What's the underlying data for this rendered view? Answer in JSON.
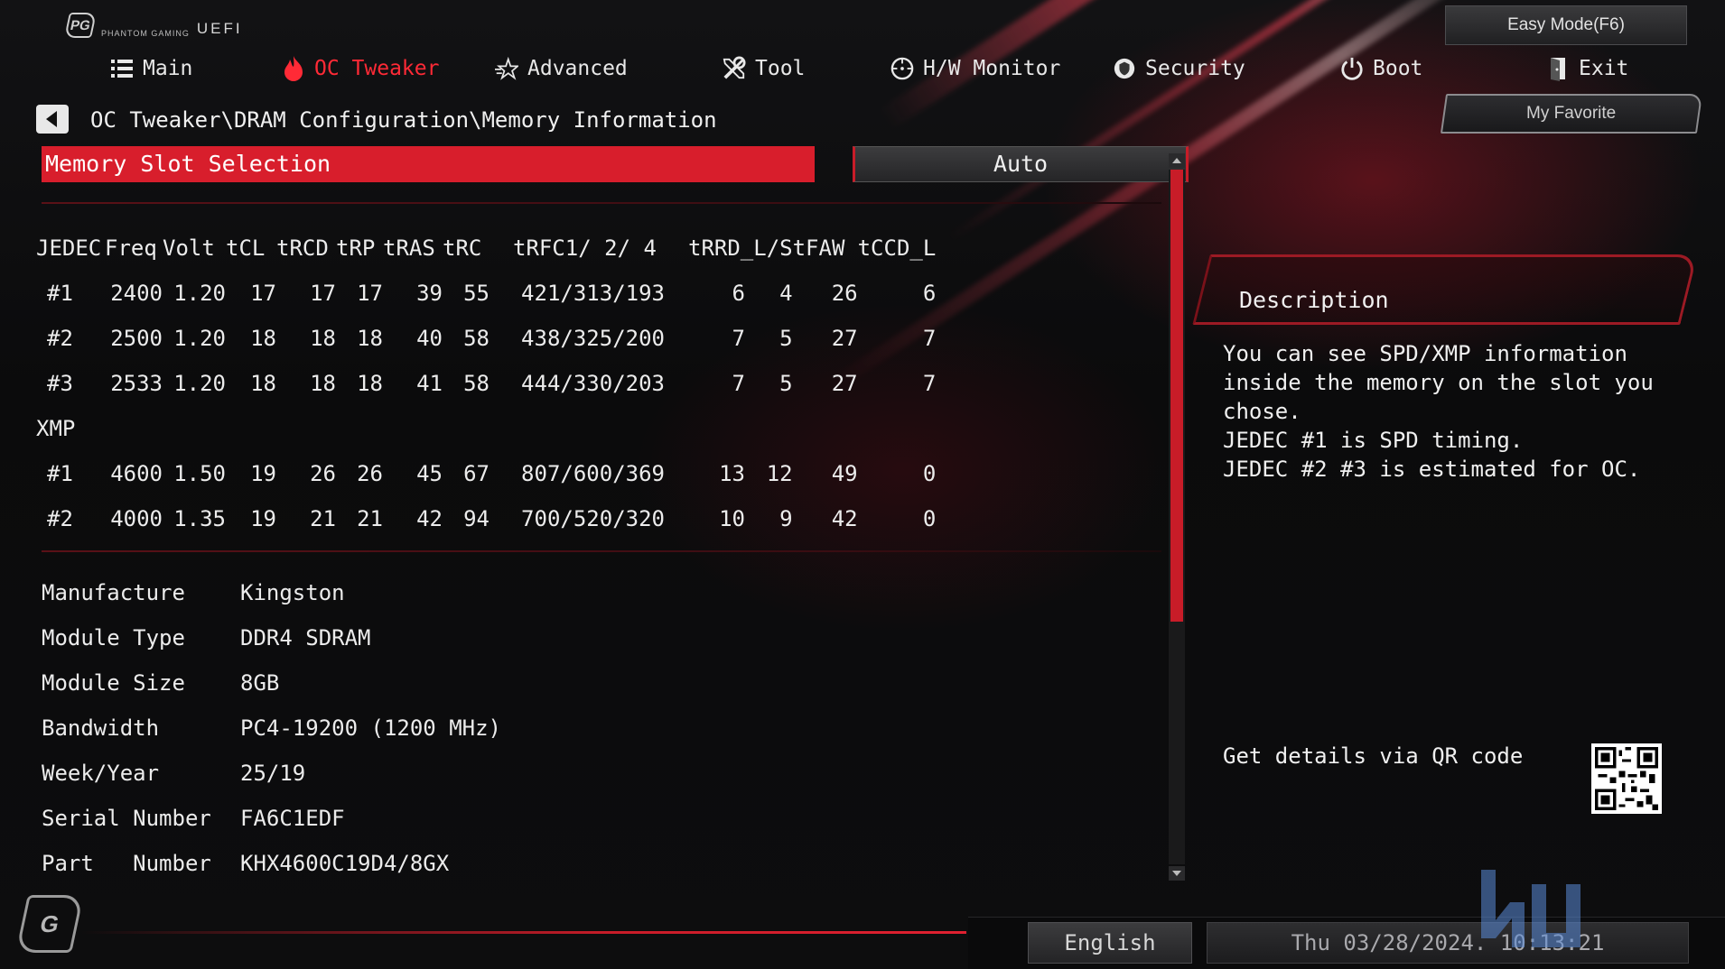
{
  "header": {
    "brand_text": "PHANTOM GAMING",
    "uefi_label": "UEFI",
    "easy_mode_label": "Easy Mode(F6)",
    "my_favorite_label": "My Favorite"
  },
  "nav": {
    "items": [
      {
        "label": "Main",
        "icon": "list-icon"
      },
      {
        "label": "OC Tweaker",
        "icon": "flame-icon",
        "active": true
      },
      {
        "label": "Advanced",
        "icon": "star-icon"
      },
      {
        "label": "Tool",
        "icon": "tools-icon"
      },
      {
        "label": "H/W Monitor",
        "icon": "monitor-gauge-icon"
      },
      {
        "label": "Security",
        "icon": "shield-icon"
      },
      {
        "label": "Boot",
        "icon": "power-icon"
      },
      {
        "label": "Exit",
        "icon": "exit-door-icon"
      }
    ]
  },
  "breadcrumb": "OC Tweaker\\DRAM Configuration\\Memory Information",
  "slot_selection": {
    "label": "Memory Slot Selection",
    "value": "Auto"
  },
  "timings": {
    "columns": [
      "JEDEC",
      "Freq",
      "Volt",
      "tCL",
      "tRCD",
      "tRP",
      "tRAS",
      "tRC",
      "tRFC1/  2/  4",
      "tRRD_L/S",
      "",
      "tFAW",
      "tCCD_L"
    ],
    "jedec_rows": [
      [
        "#1",
        "2400",
        "1.20",
        "17",
        "17",
        "17",
        "39",
        "55",
        "421/313/193",
        "6",
        "4",
        "26",
        "6"
      ],
      [
        "#2",
        "2500",
        "1.20",
        "18",
        "18",
        "18",
        "40",
        "58",
        "438/325/200",
        "7",
        "5",
        "27",
        "7"
      ],
      [
        "#3",
        "2533",
        "1.20",
        "18",
        "18",
        "18",
        "41",
        "58",
        "444/330/203",
        "7",
        "5",
        "27",
        "7"
      ]
    ],
    "xmp_label": "XMP",
    "xmp_rows": [
      [
        "#1",
        "4600",
        "1.50",
        "19",
        "26",
        "26",
        "45",
        "67",
        "807/600/369",
        "13",
        "12",
        "49",
        "0"
      ],
      [
        "#2",
        "4000",
        "1.35",
        "19",
        "21",
        "21",
        "42",
        "94",
        "700/520/320",
        "10",
        "9",
        "42",
        "0"
      ]
    ]
  },
  "module_info": [
    {
      "key": "Manufacture",
      "value": "Kingston"
    },
    {
      "key": "Module Type",
      "value": "DDR4 SDRAM"
    },
    {
      "key": "Module Size",
      "value": "8GB"
    },
    {
      "key": "Bandwidth",
      "value": "PC4-19200 (1200 MHz)"
    },
    {
      "key": "Week/Year",
      "value": "25/19"
    },
    {
      "key": "Serial Number",
      "value": "FA6C1EDF"
    },
    {
      "key": "Part   Number",
      "value": "KHX4600C19D4/8GX"
    }
  ],
  "description": {
    "title": "Description",
    "lines": [
      "You can see SPD/XMP information",
      "inside the memory on the slot you",
      "chose.",
      "JEDEC #1 is SPD timing.",
      "JEDEC #2 #3 is estimated for OC."
    ],
    "qr_label": "Get details via QR code"
  },
  "scrollbar": {
    "thumb_fraction": 0.65
  },
  "footer": {
    "language": "English",
    "datetime": "Thu 03/28/2024. 10:13:21"
  },
  "colors": {
    "accent_red": "#d81e2c",
    "active_tab_red": "#ff2a36",
    "background": "#0b0b0c",
    "text": "#ececec"
  }
}
